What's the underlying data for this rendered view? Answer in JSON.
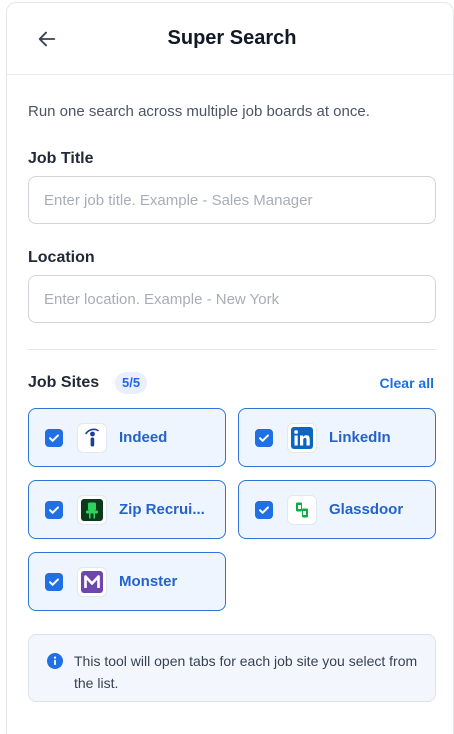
{
  "header": {
    "title": "Super Search",
    "back_icon": "arrow-left-icon"
  },
  "description": "Run one search across multiple job boards at once.",
  "job_title": {
    "label": "Job Title",
    "value": "",
    "placeholder": "Enter job title. Example - Sales Manager"
  },
  "location": {
    "label": "Location",
    "value": "",
    "placeholder": "Enter location. Example - New York"
  },
  "job_sites": {
    "label": "Job Sites",
    "count": "5/5",
    "clear_all": "Clear all",
    "sites": [
      {
        "name": "Indeed",
        "checked": true,
        "icon": "indeed-logo-icon"
      },
      {
        "name": "LinkedIn",
        "checked": true,
        "icon": "linkedin-logo-icon"
      },
      {
        "name": "Zip Recrui...",
        "checked": true,
        "icon": "ziprecruiter-logo-icon"
      },
      {
        "name": "Glassdoor",
        "checked": true,
        "icon": "glassdoor-logo-icon"
      },
      {
        "name": "Monster",
        "checked": true,
        "icon": "monster-logo-icon"
      }
    ]
  },
  "info": {
    "text": "This tool will open tabs for each job site you select from the list.",
    "icon": "info-icon"
  },
  "colors": {
    "accent": "#1f6fe5",
    "card_bg": "#eff5fe",
    "card_border": "#2f74d8",
    "link": "#1d6fe0",
    "info_bg": "#f3f7fd"
  }
}
